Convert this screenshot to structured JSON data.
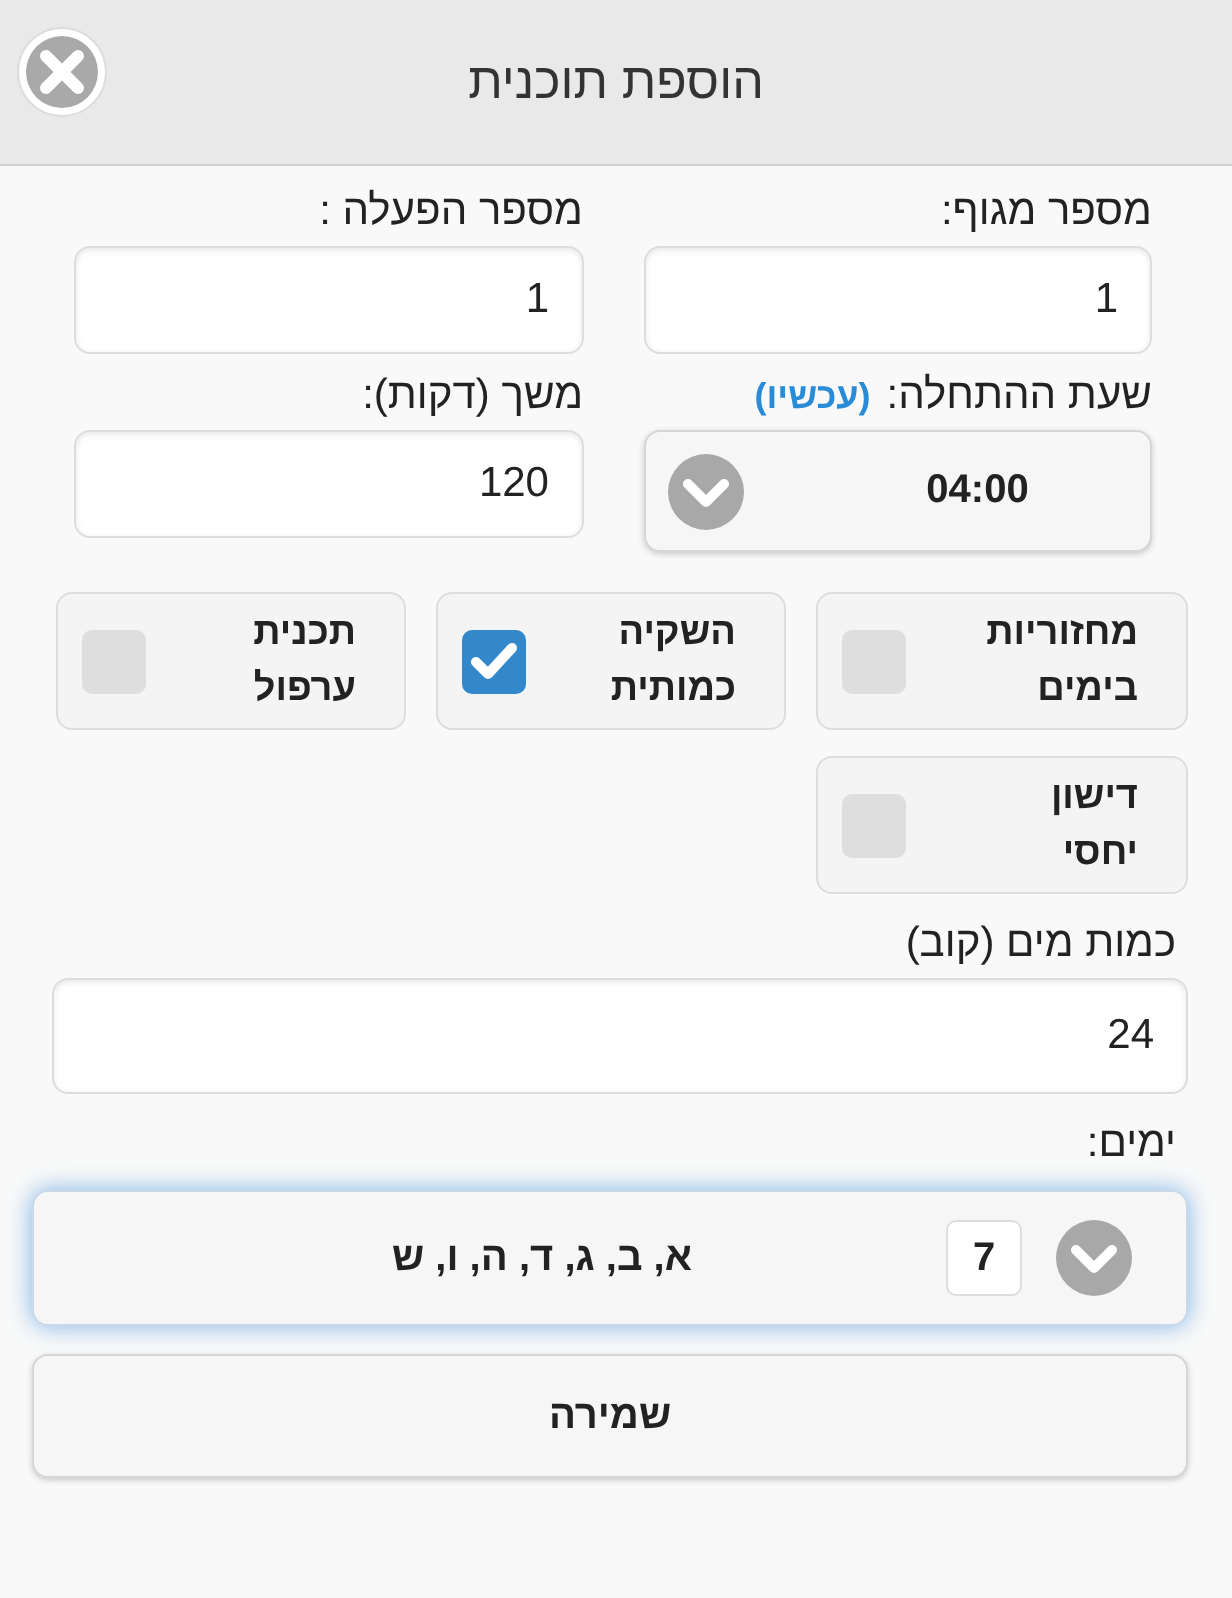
{
  "dialog": {
    "title": "הוספת תוכנית"
  },
  "top_fields": [
    {
      "label": "מספר מגוף:",
      "value": "1"
    },
    {
      "label": "מספר הפעלה :",
      "value": "1"
    }
  ],
  "start_time": {
    "label": "שעת ההתחלה:",
    "link": "(עכשיו)",
    "value": "04:00"
  },
  "duration": {
    "label": "משך (דקות):",
    "value": "120"
  },
  "options": [
    {
      "label": "מחזוריות בימים",
      "checked": false
    },
    {
      "label": "השקיה כמותית",
      "checked": true
    },
    {
      "label": "תכנית ערפול",
      "checked": false
    },
    {
      "label": "דישון יחסי",
      "checked": false
    }
  ],
  "water": {
    "label": "כמות מים (קוב)",
    "value": "24"
  },
  "days": {
    "label": "ימים:",
    "count": "7",
    "value": "א, ב, ג, ד, ה, ו, ש"
  },
  "save_button": "שמירה"
}
